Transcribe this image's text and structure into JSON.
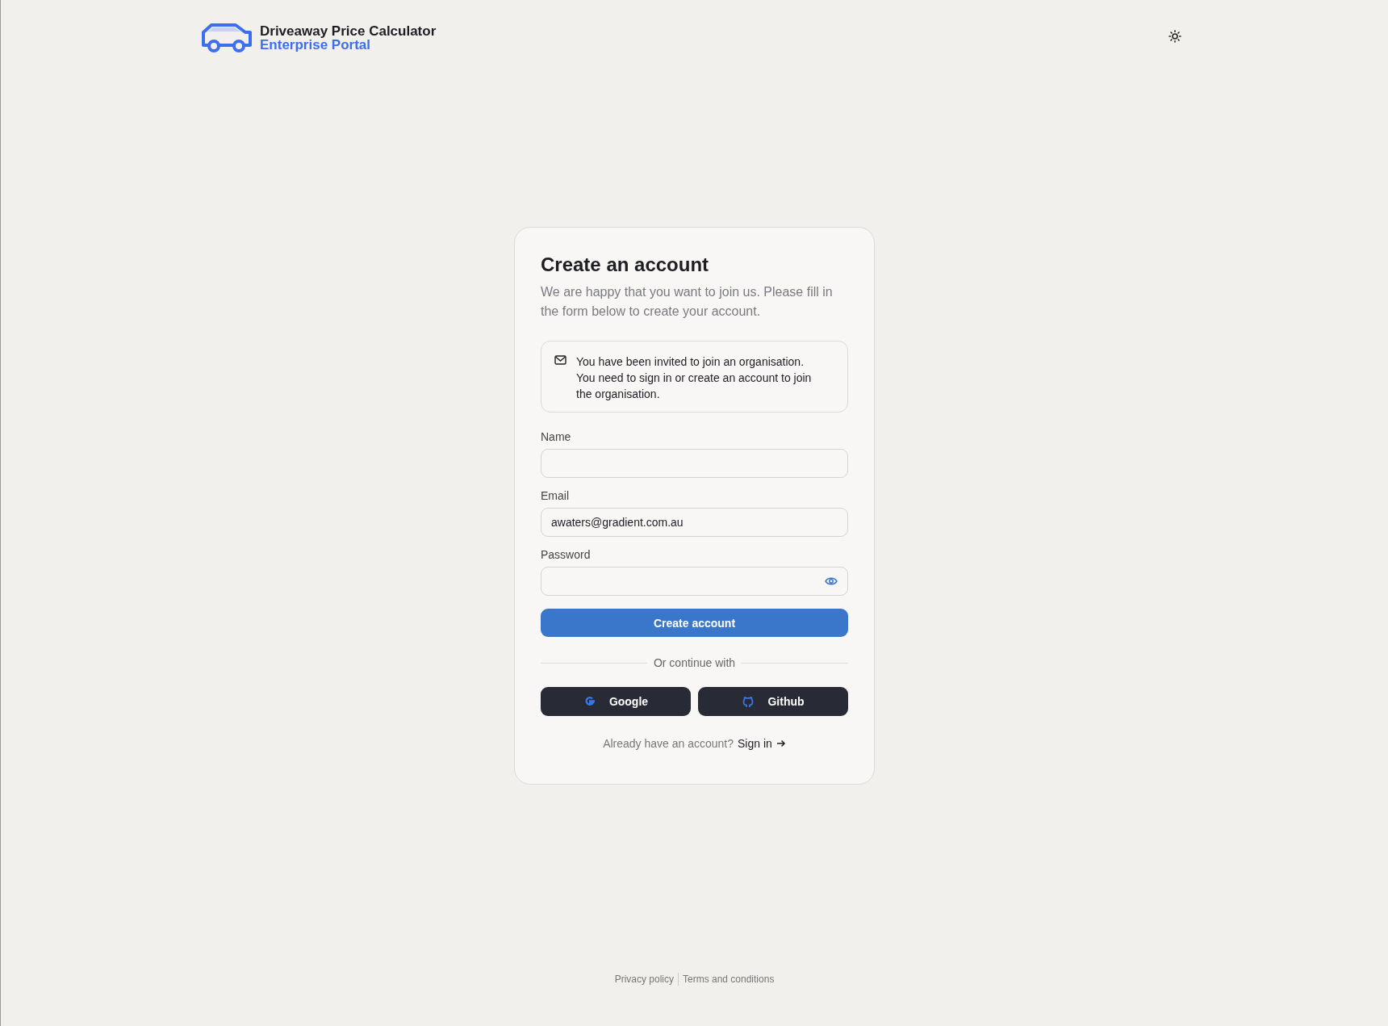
{
  "header": {
    "title": "Driveaway Price Calculator",
    "subtitle": "Enterprise Portal"
  },
  "card": {
    "title": "Create an account",
    "description": "We are happy that you want to join us. Please fill in the form below to create your account.",
    "notice": {
      "heading": "You have been invited to join an organisation.",
      "body": "You need to sign in or create an account to join the organisation."
    },
    "fields": [
      {
        "label": "Name",
        "kind": "text"
      },
      {
        "label": "Email",
        "kind": "text",
        "value": "awaters@gradient.com.au"
      },
      {
        "label": "Password",
        "kind": "password"
      }
    ],
    "submit": "Create account",
    "divider": "Or continue with",
    "social": [
      {
        "label": "Google",
        "kind": "google"
      },
      {
        "label": "Github",
        "kind": "github"
      }
    ],
    "signin_prompt": "Already have an account?",
    "signin_link": "Sign in"
  },
  "footer": {
    "links": [
      "Privacy policy",
      "Terms and conditions"
    ]
  }
}
